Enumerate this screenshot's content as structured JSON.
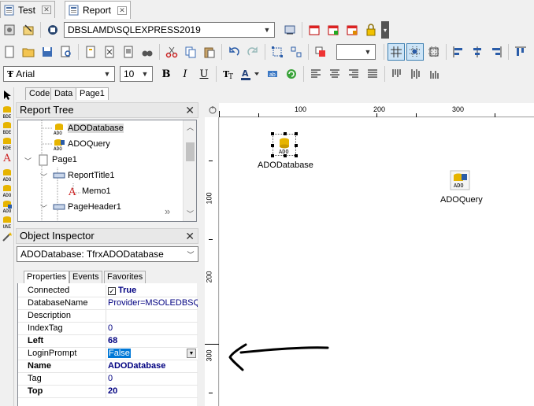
{
  "doc_tabs": [
    {
      "label": "Test",
      "active": false
    },
    {
      "label": "Report",
      "active": true
    }
  ],
  "toolbar": {
    "connection": "DBSLAMD\\SQLEXPRESS2019",
    "font_name": "Arial",
    "font_size": "10",
    "format_buttons": {
      "bold": "B",
      "italic": "I",
      "underline": "U"
    }
  },
  "editor_tabs": [
    "Code",
    "Data",
    "Page1"
  ],
  "report_tree": {
    "title": "Report Tree",
    "items": [
      {
        "label": "ADODatabase",
        "selected": true
      },
      {
        "label": "ADOQuery",
        "selected": false
      },
      {
        "label": "Page1",
        "selected": false
      },
      {
        "label": "ReportTitle1",
        "selected": false
      },
      {
        "label": "Memo1",
        "selected": false
      },
      {
        "label": "PageHeader1",
        "selected": false
      }
    ]
  },
  "object_inspector": {
    "title": "Object Inspector",
    "selected_object": "ADODatabase: TfrxADODatabase",
    "tabs": [
      "Properties",
      "Events",
      "Favorites"
    ],
    "properties": [
      {
        "name": "Connected",
        "value": "True",
        "bold": false,
        "checkbox": true
      },
      {
        "name": "DatabaseName",
        "value": "Provider=MSOLEDBSQL",
        "bold": false
      },
      {
        "name": "Description",
        "value": "",
        "bold": false
      },
      {
        "name": "IndexTag",
        "value": "0",
        "bold": false
      },
      {
        "name": "Left",
        "value": "68",
        "bold": true
      },
      {
        "name": "LoginPrompt",
        "value": "False",
        "bold": false,
        "editing": true
      },
      {
        "name": "Name",
        "value": "ADODatabase",
        "bold": true
      },
      {
        "name": "Tag",
        "value": "0",
        "bold": false
      },
      {
        "name": "Top",
        "value": "20",
        "bold": true
      }
    ]
  },
  "rulers": {
    "top_labels": [
      "100",
      "200",
      "300"
    ],
    "left_labels": [
      "100",
      "200",
      "300"
    ]
  },
  "design_components": [
    {
      "label": "ADODatabase",
      "selected": true
    },
    {
      "label": "ADOQuery",
      "selected": false
    }
  ],
  "palette_labels": [
    "BDE",
    "BDE",
    "BDE",
    "A",
    "ADO",
    "ADO",
    "ADO",
    "UNI"
  ],
  "colors": {
    "selection_blue": "#0078d7",
    "value_navy": "#000080",
    "window_bg": "#f0f0f0"
  }
}
